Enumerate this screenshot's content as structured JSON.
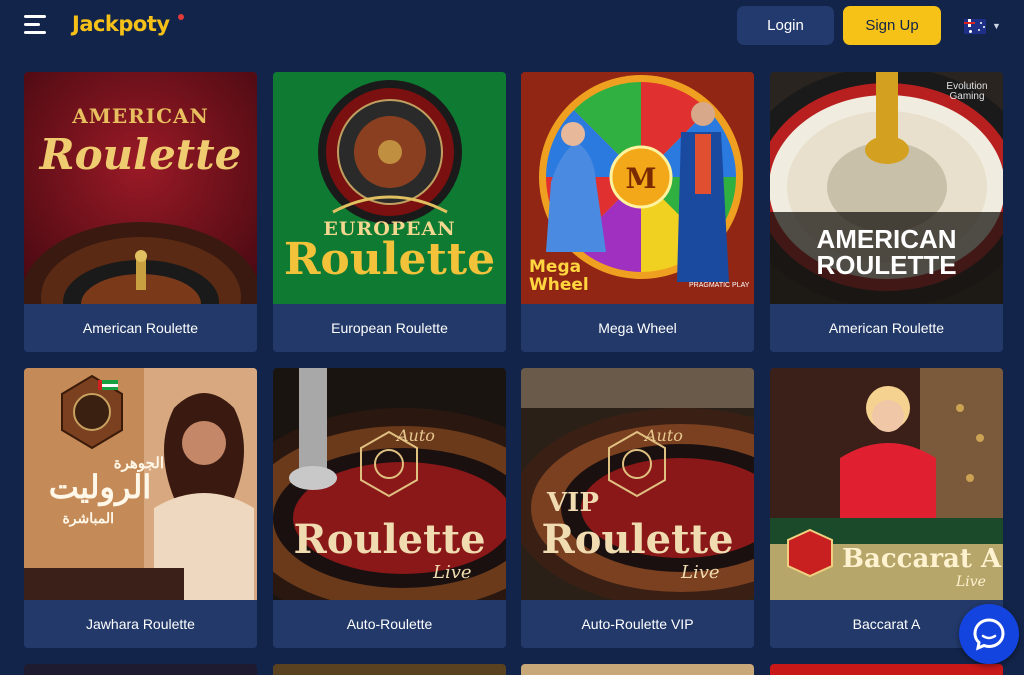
{
  "header": {
    "brand": "Jackpoty",
    "login_label": "Login",
    "signup_label": "Sign Up",
    "language_icon": "australia-flag-icon",
    "menu_icon": "hamburger-menu-icon"
  },
  "colors": {
    "background": "#13244a",
    "card": "#22396a",
    "accent_yellow": "#f7c217",
    "login_button": "#233a6e",
    "chat_button": "#1444e0"
  },
  "games": [
    {
      "title": "American Roulette",
      "art_line1": "AMERICAN",
      "art_line2": "Roulette"
    },
    {
      "title": "European Roulette",
      "art_line1": "EUROPEAN",
      "art_line2": "Roulette"
    },
    {
      "title": "Mega Wheel",
      "art_line1": "Mega",
      "art_line2": "Wheel",
      "art_badge": "PRAGMATIC PLAY",
      "art_letter": "M"
    },
    {
      "title": "American Roulette",
      "art_line1": "AMERICAN",
      "art_line2": "ROULETTE",
      "art_badge": "Evolution Gaming"
    },
    {
      "title": "Jawhara Roulette",
      "art_line1": "الجوهرة",
      "art_line2": "الروليت",
      "art_line3": "المباشرة"
    },
    {
      "title": "Auto-Roulette",
      "art_line1": "Auto",
      "art_line2": "Roulette",
      "art_line3": "Live"
    },
    {
      "title": "Auto-Roulette VIP",
      "art_line1": "Auto",
      "art_line0": "VIP",
      "art_line2": "Roulette",
      "art_line3": "Live"
    },
    {
      "title": "Baccarat A",
      "art_line2": "Baccarat A",
      "art_line3": "Live"
    }
  ],
  "chat_icon": "chat-bubble-icon"
}
